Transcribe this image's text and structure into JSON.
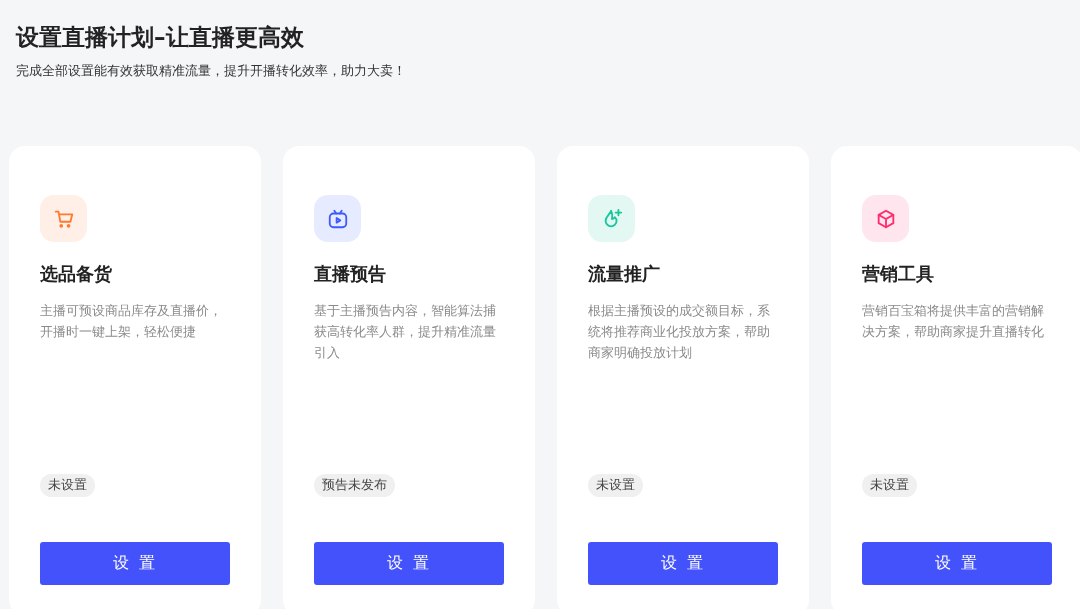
{
  "header": {
    "title": "设置直播计划–让直播更高效",
    "subtitle": "完成全部设置能有效获取精准流量，提升开播转化效率，助力大卖！"
  },
  "cards": [
    {
      "kind": "cart",
      "color": "#ff7a2e",
      "title": "选品备货",
      "description": "主播可预设商品库存及直播价，开播时一键上架，轻松便捷",
      "status": "未设置",
      "button": "设 置"
    },
    {
      "kind": "video",
      "color": "#3d5afe",
      "title": "直播预告",
      "description": "基于主播预告内容，智能算法捕获高转化率人群，提升精准流量引入",
      "status": "预告未发布",
      "button": "设 置"
    },
    {
      "kind": "flame",
      "color": "#16c79a",
      "title": "流量推广",
      "description": "根据主播预设的成交额目标，系统将推荐商业化投放方案，帮助商家明确投放计划",
      "status": "未设置",
      "button": "设 置"
    },
    {
      "kind": "cube",
      "color": "#ff2d6f",
      "title": "营销工具",
      "description": "营销百宝箱将提供丰富的营销解决方案，帮助商家提升直播转化",
      "status": "未设置",
      "button": "设 置"
    }
  ]
}
